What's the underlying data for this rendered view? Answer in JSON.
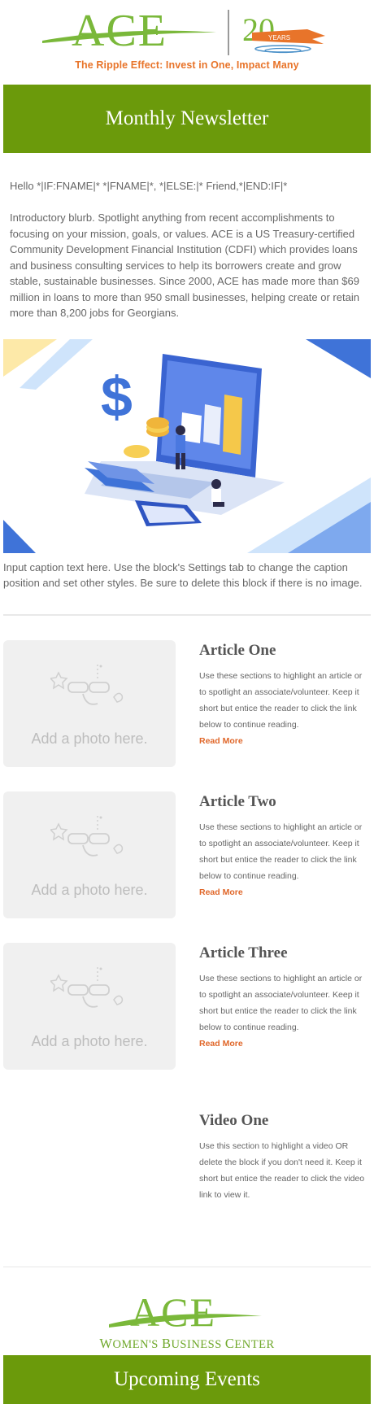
{
  "header": {
    "logo_text": "ACE",
    "anniversary_number": "20",
    "anniversary_word": "YEARS",
    "tagline": "The Ripple Effect: Invest in One, Impact Many"
  },
  "newsletter": {
    "title": "Monthly Newsletter",
    "greeting": "Hello *|IF:FNAME|* *|FNAME|*, *|ELSE:|* Friend,*|END:IF|*",
    "intro": "Introductory blurb. Spotlight anything from recent accomplishments to focusing on your mission, goals, or values. ACE is a US Treasury-certified Community Development Financial Institution (CDFI) which provides loans and business consulting services to help its borrowers create and grow stable, sustainable businesses. Since 2000, ACE has made more than $69 million in loans to more than 950 small businesses, helping create or retain more than 8,200 jobs for Georgians.",
    "caption": "Input caption text here. Use the block's Settings tab to change the caption position and set other styles. Be sure to delete this block if there is no image."
  },
  "articles": [
    {
      "photo_placeholder": "Add a photo here.",
      "title": "Article One",
      "body": "Use these sections to highlight an article or to spotlight an associate/volunteer. Keep it short but entice the reader to click the link below to continue reading.",
      "link": "Read More"
    },
    {
      "photo_placeholder": "Add a photo here.",
      "title": "Article Two",
      "body": "Use these sections to highlight an article or to spotlight an associate/volunteer. Keep it short but entice the reader to click the link below to continue reading.",
      "link": "Read More"
    },
    {
      "photo_placeholder": "Add a photo here.",
      "title": "Article Three",
      "body": "Use these sections to highlight an article or to spotlight an associate/volunteer. Keep it short but entice the reader to click the link below to continue reading.",
      "link": "Read More"
    }
  ],
  "video": {
    "title": "Video One",
    "body": "Use this section to highlight a video OR delete the block if you don't need it. Keep it short but entice the reader to click the video link to view it."
  },
  "footer": {
    "logo_text": "ACE",
    "subtitle_parts": [
      "W",
      "OMEN'S ",
      "B",
      "USINESS ",
      "C",
      "ENTER"
    ],
    "events_title": "Upcoming Events"
  },
  "colors": {
    "brand_green": "#6b9a0b",
    "logo_green": "#7ab83a",
    "accent_orange": "#e0672a"
  }
}
